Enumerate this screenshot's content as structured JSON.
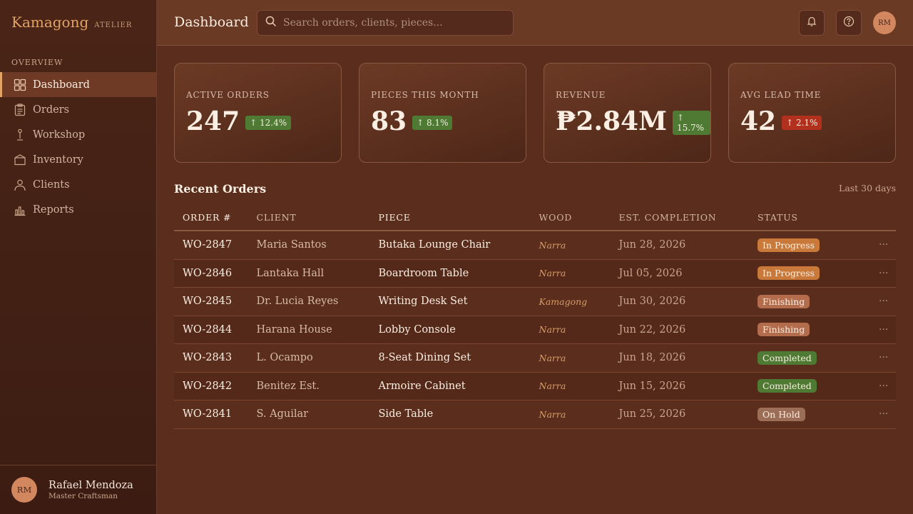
{
  "brand": {
    "name": "Kamagong",
    "sub": "ATELIER"
  },
  "sidebar": {
    "section_label": "OVERVIEW",
    "items": [
      {
        "label": "Dashboard",
        "icon": "grid-icon",
        "active": true
      },
      {
        "label": "Orders",
        "icon": "clipboard-icon",
        "active": false
      },
      {
        "label": "Workshop",
        "icon": "chisel-icon",
        "active": false
      },
      {
        "label": "Inventory",
        "icon": "box-icon",
        "active": false
      },
      {
        "label": "Clients",
        "icon": "user-icon",
        "active": false
      },
      {
        "label": "Reports",
        "icon": "bar-chart-icon",
        "active": false
      }
    ],
    "user": {
      "initials": "RM",
      "name": "Rafael Mendoza",
      "role": "Master Craftsman"
    }
  },
  "header": {
    "title": "Dashboard",
    "search_placeholder": "Search orders, clients, pieces...",
    "avatar_initials": "RM"
  },
  "stats": [
    {
      "label": "ACTIVE ORDERS",
      "value": "247",
      "change": "↑ 12.4%",
      "trend": "up"
    },
    {
      "label": "PIECES THIS MONTH",
      "value": "83",
      "change": "↑ 8.1%",
      "trend": "up"
    },
    {
      "label": "REVENUE",
      "value": "₱2.84M",
      "change": "↑ 15.7%",
      "trend": "up"
    },
    {
      "label": "AVG LEAD TIME",
      "value": "42",
      "change": "↑ 2.1%",
      "trend": "down"
    }
  ],
  "orders": {
    "title": "Recent Orders",
    "range": "Last 30 days",
    "columns": [
      "ORDER #",
      "CLIENT",
      "PIECE",
      "WOOD",
      "EST. COMPLETION",
      "STATUS"
    ],
    "rows": [
      {
        "order": "WO-2847",
        "client": "Maria Santos",
        "piece": "Butaka Lounge Chair",
        "wood": "Narra",
        "completion": "Jun 28, 2026",
        "status": "In Progress",
        "status_class": "inprogress"
      },
      {
        "order": "WO-2846",
        "client": "Lantaka Hall",
        "piece": "Boardroom Table",
        "wood": "Narra",
        "completion": "Jul 05, 2026",
        "status": "In Progress",
        "status_class": "inprogress"
      },
      {
        "order": "WO-2845",
        "client": "Dr. Lucia Reyes",
        "piece": "Writing Desk Set",
        "wood": "Kamagong",
        "completion": "Jun 30, 2026",
        "status": "Finishing",
        "status_class": "finishing"
      },
      {
        "order": "WO-2844",
        "client": "Harana House",
        "piece": "Lobby Console",
        "wood": "Narra",
        "completion": "Jun 22, 2026",
        "status": "Finishing",
        "status_class": "finishing"
      },
      {
        "order": "WO-2843",
        "client": "L. Ocampo",
        "piece": "8-Seat Dining Set",
        "wood": "Narra",
        "completion": "Jun 18, 2026",
        "status": "Completed",
        "status_class": "completed"
      },
      {
        "order": "WO-2842",
        "client": "Benitez Est.",
        "piece": "Armoire Cabinet",
        "wood": "Narra",
        "completion": "Jun 15, 2026",
        "status": "Completed",
        "status_class": "completed"
      },
      {
        "order": "WO-2841",
        "client": "S. Aguilar",
        "piece": "Side Table",
        "wood": "Narra",
        "completion": "Jun 25, 2026",
        "status": "On Hold",
        "status_class": "onhold"
      }
    ],
    "row_menu": "···"
  }
}
